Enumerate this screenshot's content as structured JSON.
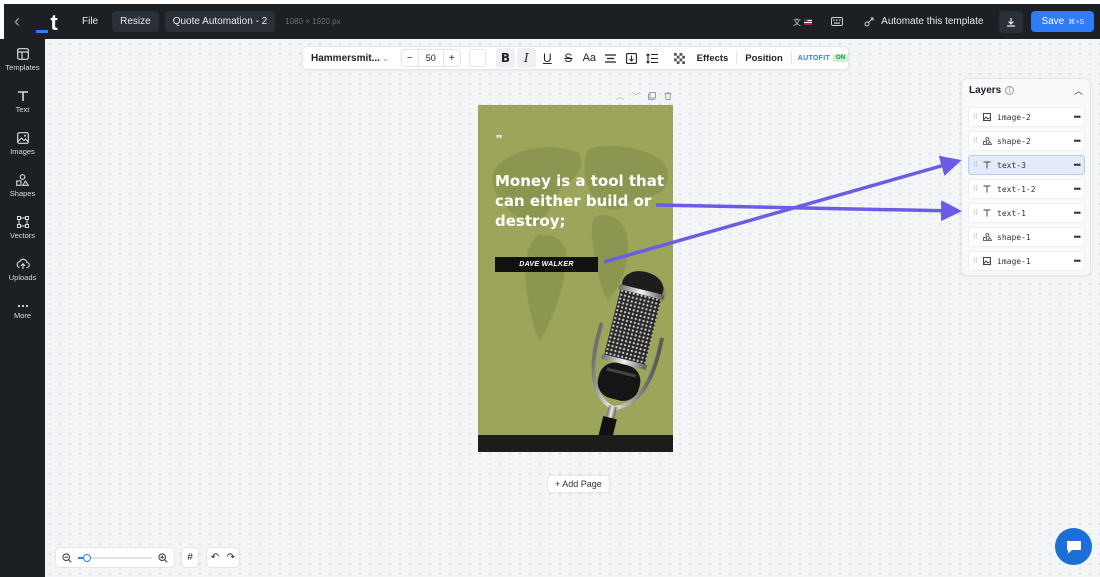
{
  "topbar": {
    "file": "File",
    "resize": "Resize",
    "title": "Quote Automation - 2",
    "dims": "1080 × 1920 px",
    "automate": "Automate this template",
    "save": "Save",
    "save_kbd": "⌘+S",
    "accent": "#2f7cf6"
  },
  "sidebar": {
    "items": [
      {
        "label": "Templates",
        "icon": "templates-icon"
      },
      {
        "label": "Text",
        "icon": "text-icon"
      },
      {
        "label": "Images",
        "icon": "images-icon"
      },
      {
        "label": "Shapes",
        "icon": "shapes-icon"
      },
      {
        "label": "Vectors",
        "icon": "vectors-icon"
      },
      {
        "label": "Uploads",
        "icon": "uploads-icon"
      },
      {
        "label": "More",
        "icon": "more-icon"
      }
    ]
  },
  "format_toolbar": {
    "font": "Hammersmit...",
    "size": "50",
    "effects": "Effects",
    "position": "Position",
    "autofit": "AUTOFIT",
    "autofit_state": "ON"
  },
  "design": {
    "quote_mark": "❞",
    "quote": "Money is a tool that can either build or destroy;",
    "author": "DAVE WALKER",
    "background": "#9ca55a"
  },
  "add_page": "+ Add Page",
  "layers": {
    "title": "Layers",
    "items": [
      {
        "name": "image-2",
        "type": "image"
      },
      {
        "name": "shape-2",
        "type": "shape"
      },
      {
        "name": "text-3",
        "type": "text",
        "active": true
      },
      {
        "name": "text-1-2",
        "type": "text"
      },
      {
        "name": "text-1",
        "type": "text"
      },
      {
        "name": "shape-1",
        "type": "shape"
      },
      {
        "name": "image-1",
        "type": "image"
      }
    ]
  },
  "zoom": {
    "level_fraction": 0.12
  },
  "annotation_arrow_color": "#6b5ce7"
}
